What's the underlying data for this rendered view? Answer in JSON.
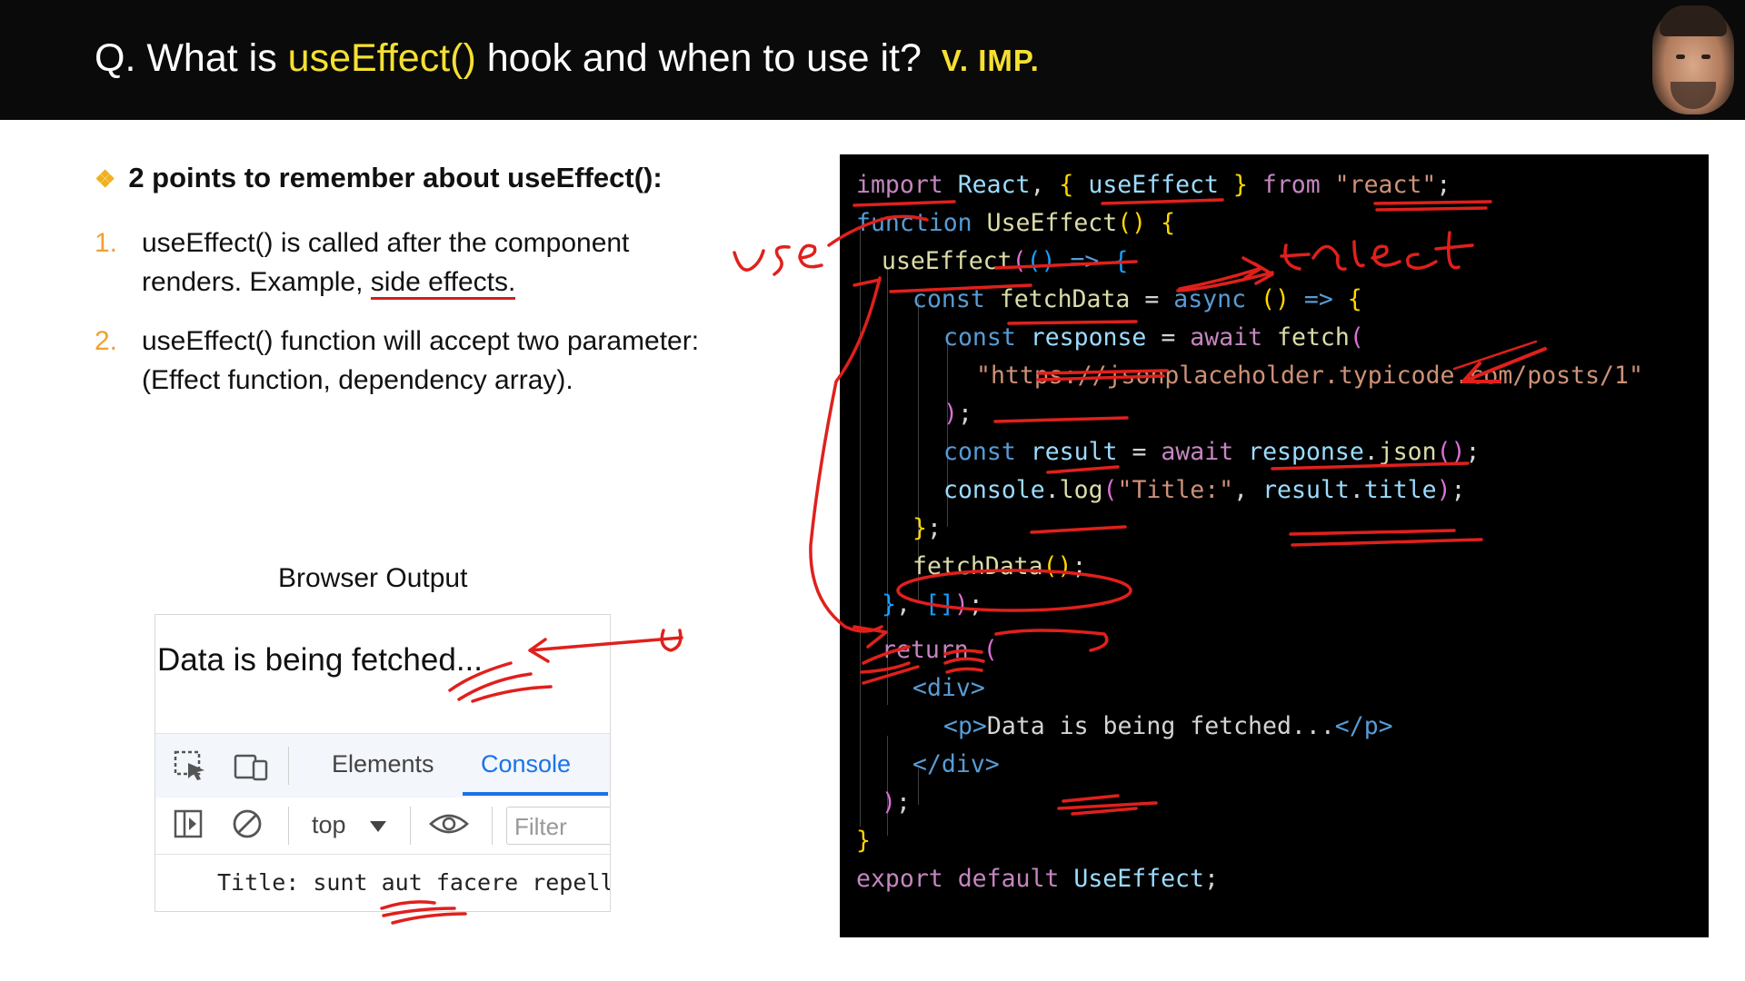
{
  "header": {
    "prefix": "Q. What is ",
    "highlight": "useEffect()",
    "suffix": " hook and when to use it?",
    "badge": "V. IMP."
  },
  "points": {
    "heading": "2 points to remember about useEffect():",
    "items": [
      {
        "num": "1.",
        "text_a": "useEffect() is called after the component renders. Example, ",
        "text_u": "side effects."
      },
      {
        "num": "2.",
        "text": "useEffect() function will accept two parameter: (Effect function, dependency array)."
      }
    ]
  },
  "browser_output": {
    "caption": "Browser Output",
    "page_text": "Data is being fetched...",
    "devtools": {
      "tabs": [
        "Elements",
        "Console"
      ],
      "active_tab": "Console",
      "context": "top",
      "filter_placeholder": "Filter",
      "log_line": "Title: sunt aut facere repellat"
    }
  },
  "code": {
    "l1": {
      "import": "import",
      "react": "React",
      "comma": ",",
      "ob": "{",
      "useEffect": "useEffect",
      "cb": "}",
      "from": "from",
      "mod": "\"react\"",
      "semi": ";"
    },
    "l2": {
      "function": "function",
      "name": "UseEffect",
      "parens": "()",
      "ob": "{"
    },
    "l3": {
      "call": "useEffect",
      "op": "(",
      "args": "()",
      "arrow": "=>",
      "ob": "{"
    },
    "l4": {
      "const": "const",
      "name": "fetchData",
      "eq": "=",
      "async": "async",
      "args": "()",
      "arrow": "=>",
      "ob": "{"
    },
    "l5": {
      "const": "const",
      "name": "response",
      "eq": "=",
      "await": "await",
      "fetch": "fetch",
      "op": "("
    },
    "l6": {
      "url": "\"https://jsonplaceholder.typicode.com/posts/1\""
    },
    "l7": {
      "cp": ")",
      "semi": ";"
    },
    "l8": {
      "const": "const",
      "name": "result",
      "eq": "=",
      "await": "await",
      "obj": "response",
      "dot": ".",
      "method": "json",
      "parens": "()",
      "semi": ";"
    },
    "l9": {
      "obj": "console",
      "dot": ".",
      "method": "log",
      "op": "(",
      "str": "\"Title:\"",
      "comma": ",",
      "obj2": "result",
      "dot2": ".",
      "prop": "title",
      "cp": ")",
      "semi": ";"
    },
    "l10": {
      "cb": "}",
      "semi": ";"
    },
    "l11": {
      "call": "fetchData",
      "parens": "()",
      "semi": ";"
    },
    "l12": {
      "cb": "}",
      "comma": ",",
      "deps": "[]",
      "cp": ")",
      "semi": ";"
    },
    "l13": {
      "return": "return",
      "op": "("
    },
    "l14": {
      "open": "<div>"
    },
    "l15": {
      "popen": "<p>",
      "text": "Data is being fetched...",
      "pclose": "</p>"
    },
    "l16": {
      "close": "</div>"
    },
    "l17": {
      "cp": ")",
      "semi": ";"
    },
    "l18": {
      "cb": "}"
    },
    "l19": {
      "export": "export",
      "default": "default",
      "name": "UseEffect",
      "semi": ";"
    }
  },
  "annotations": {
    "ink_color": "#e0201c",
    "handwriting": [
      "use",
      "effect"
    ]
  }
}
